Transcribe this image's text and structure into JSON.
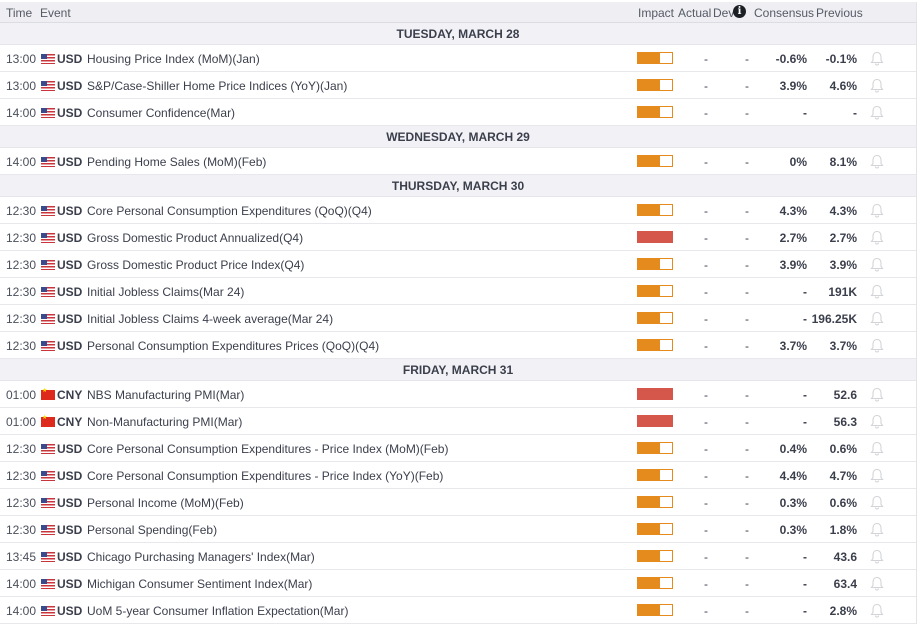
{
  "header": {
    "time": "Time",
    "event": "Event",
    "impact": "Impact",
    "actual": "Actual",
    "dev": "Dev",
    "info_icon": "i",
    "consensus": "Consensus",
    "previous": "Previous"
  },
  "colors": {
    "medium": "#e58a1d",
    "high": "#d5564a"
  },
  "days": [
    {
      "date": "TUESDAY, MARCH 28",
      "events": [
        {
          "time": "13:00",
          "flag": "us",
          "currency": "USD",
          "event": "Housing Price Index (MoM)(Jan)",
          "impact": "medium",
          "actual": "-",
          "dev": "-",
          "consensus": "-0.6%",
          "previous": "-0.1%"
        },
        {
          "time": "13:00",
          "flag": "us",
          "currency": "USD",
          "event": "S&P/Case-Shiller Home Price Indices (YoY)(Jan)",
          "impact": "medium",
          "actual": "-",
          "dev": "-",
          "consensus": "3.9%",
          "previous": "4.6%"
        },
        {
          "time": "14:00",
          "flag": "us",
          "currency": "USD",
          "event": "Consumer Confidence(Mar)",
          "impact": "medium",
          "actual": "-",
          "dev": "-",
          "consensus": "-",
          "previous": "-"
        }
      ]
    },
    {
      "date": "WEDNESDAY, MARCH 29",
      "events": [
        {
          "time": "14:00",
          "flag": "us",
          "currency": "USD",
          "event": "Pending Home Sales (MoM)(Feb)",
          "impact": "medium",
          "actual": "-",
          "dev": "-",
          "consensus": "0%",
          "previous": "8.1%"
        }
      ]
    },
    {
      "date": "THURSDAY, MARCH 30",
      "events": [
        {
          "time": "12:30",
          "flag": "us",
          "currency": "USD",
          "event": "Core Personal Consumption Expenditures (QoQ)(Q4)",
          "impact": "medium",
          "actual": "-",
          "dev": "-",
          "consensus": "4.3%",
          "previous": "4.3%"
        },
        {
          "time": "12:30",
          "flag": "us",
          "currency": "USD",
          "event": "Gross Domestic Product Annualized(Q4)",
          "impact": "high",
          "actual": "-",
          "dev": "-",
          "consensus": "2.7%",
          "previous": "2.7%"
        },
        {
          "time": "12:30",
          "flag": "us",
          "currency": "USD",
          "event": "Gross Domestic Product Price Index(Q4)",
          "impact": "medium",
          "actual": "-",
          "dev": "-",
          "consensus": "3.9%",
          "previous": "3.9%"
        },
        {
          "time": "12:30",
          "flag": "us",
          "currency": "USD",
          "event": "Initial Jobless Claims(Mar 24)",
          "impact": "medium",
          "actual": "-",
          "dev": "-",
          "consensus": "-",
          "previous": "191K"
        },
        {
          "time": "12:30",
          "flag": "us",
          "currency": "USD",
          "event": "Initial Jobless Claims 4-week average(Mar 24)",
          "impact": "medium",
          "actual": "-",
          "dev": "-",
          "consensus": "-",
          "previous": "196.25K"
        },
        {
          "time": "12:30",
          "flag": "us",
          "currency": "USD",
          "event": "Personal Consumption Expenditures Prices (QoQ)(Q4)",
          "impact": "medium",
          "actual": "-",
          "dev": "-",
          "consensus": "3.7%",
          "previous": "3.7%"
        }
      ]
    },
    {
      "date": "FRIDAY, MARCH 31",
      "events": [
        {
          "time": "01:00",
          "flag": "cn",
          "currency": "CNY",
          "event": "NBS Manufacturing PMI(Mar)",
          "impact": "high",
          "actual": "-",
          "dev": "-",
          "consensus": "-",
          "previous": "52.6"
        },
        {
          "time": "01:00",
          "flag": "cn",
          "currency": "CNY",
          "event": "Non-Manufacturing PMI(Mar)",
          "impact": "high",
          "actual": "-",
          "dev": "-",
          "consensus": "-",
          "previous": "56.3"
        },
        {
          "time": "12:30",
          "flag": "us",
          "currency": "USD",
          "event": "Core Personal Consumption Expenditures - Price Index (MoM)(Feb)",
          "impact": "medium",
          "actual": "-",
          "dev": "-",
          "consensus": "0.4%",
          "previous": "0.6%"
        },
        {
          "time": "12:30",
          "flag": "us",
          "currency": "USD",
          "event": "Core Personal Consumption Expenditures - Price Index (YoY)(Feb)",
          "impact": "medium",
          "actual": "-",
          "dev": "-",
          "consensus": "4.4%",
          "previous": "4.7%"
        },
        {
          "time": "12:30",
          "flag": "us",
          "currency": "USD",
          "event": "Personal Income (MoM)(Feb)",
          "impact": "medium",
          "actual": "-",
          "dev": "-",
          "consensus": "0.3%",
          "previous": "0.6%"
        },
        {
          "time": "12:30",
          "flag": "us",
          "currency": "USD",
          "event": "Personal Spending(Feb)",
          "impact": "medium",
          "actual": "-",
          "dev": "-",
          "consensus": "0.3%",
          "previous": "1.8%"
        },
        {
          "time": "13:45",
          "flag": "us",
          "currency": "USD",
          "event": "Chicago Purchasing Managers' Index(Mar)",
          "impact": "medium",
          "actual": "-",
          "dev": "-",
          "consensus": "-",
          "previous": "43.6"
        },
        {
          "time": "14:00",
          "flag": "us",
          "currency": "USD",
          "event": "Michigan Consumer Sentiment Index(Mar)",
          "impact": "medium",
          "actual": "-",
          "dev": "-",
          "consensus": "-",
          "previous": "63.4"
        },
        {
          "time": "14:00",
          "flag": "us",
          "currency": "USD",
          "event": "UoM 5-year Consumer Inflation Expectation(Mar)",
          "impact": "medium",
          "actual": "-",
          "dev": "-",
          "consensus": "-",
          "previous": "2.8%"
        }
      ]
    }
  ]
}
